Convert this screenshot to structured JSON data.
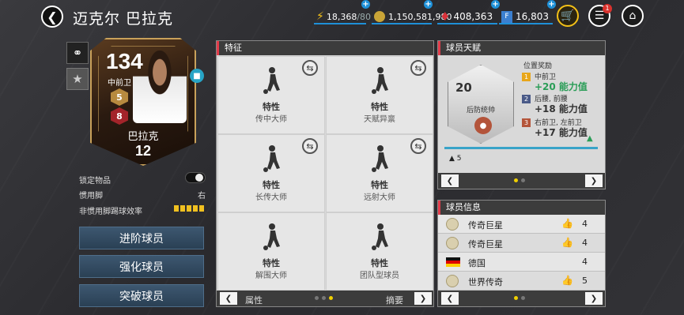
{
  "header": {
    "title": "迈克尔 巴拉克",
    "stamina": "18,368",
    "stamina_max": "/80",
    "coins": "1,150,581,980",
    "gems": "408,363",
    "fifa_points": "16,803",
    "notification_count": "1"
  },
  "card": {
    "rating": "134",
    "position": "中前卫",
    "name": "巴拉克",
    "level": "12",
    "badge_gold": "5",
    "badge_red": "8"
  },
  "info": {
    "locked_label": "锁定物品",
    "foot_label": "惯用脚",
    "foot_value": "右",
    "weak_foot_label": "非惯用脚踢球效率"
  },
  "actions": {
    "upgrade": "进阶球员",
    "enhance": "强化球员",
    "breakthrough": "突破球员"
  },
  "traits": {
    "title": "特征",
    "items": [
      {
        "label": "特性",
        "name": "传中大师"
      },
      {
        "label": "特性",
        "name": "天赋异禀"
      },
      {
        "label": "特性",
        "name": "长传大师"
      },
      {
        "label": "特性",
        "name": "远射大师"
      },
      {
        "label": "特性",
        "name": "解围大师"
      },
      {
        "label": "特性",
        "name": "团队型球员"
      }
    ],
    "footer_left": "属性",
    "footer_right": "摘要"
  },
  "talent": {
    "title": "球员天赋",
    "hex_num": "20",
    "hex_cap": "后防统帅",
    "reward_head": "位置奖励",
    "rewards": [
      {
        "num": "1",
        "pos": "中前卫",
        "val": "+20 能力值",
        "color": "#e8a61a"
      },
      {
        "num": "2",
        "pos": "后腰, 前腰",
        "val": "+18 能力值",
        "color": "#4a5a88"
      },
      {
        "num": "3",
        "pos": "右前卫, 左前卫",
        "val": "+17 能力值",
        "color": "#b4553a"
      }
    ],
    "small_value": "5"
  },
  "player_info": {
    "title": "球员信息",
    "rows": [
      {
        "text": "传奇巨星",
        "num": "4"
      },
      {
        "text": "传奇巨星",
        "num": "4"
      },
      {
        "text": "德国",
        "num": "4"
      },
      {
        "text": "世界传奇",
        "num": "5"
      }
    ]
  },
  "icons": {
    "back": "chevron-left-icon",
    "share": "share-icon",
    "star": "star-icon",
    "shop": "cart-icon",
    "menu": "menu-icon",
    "home": "home-icon",
    "swap": "swap-icon"
  }
}
